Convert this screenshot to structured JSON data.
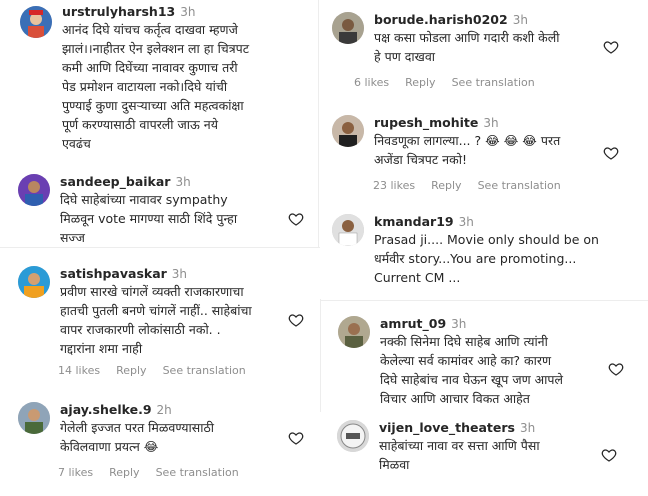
{
  "comments": [
    {
      "username": "urstrulyharsh13",
      "time": "3h",
      "text": "आनंद दिघे यांचच कर्तृत्व दाखवा म्हणजे\nझालं।।नाहीतर ऐन इलेक्शन ला हा चित्रपट\nकमी आणि दिघेंच्या नावावर कुणाच तरी\nपेड प्रमोशन वाटायला नको।दिघे यांची\nपुण्याई कुणा दुसऱ्याच्या अति महत्वकांक्षा\nपूर्ण करण्यासाठी वापरली जाऊ नये\nएवढंच",
      "likes": "",
      "reply": "",
      "translate": ""
    },
    {
      "username": "sandeep_baikar",
      "time": "3h",
      "text": "दिघे साहेबांच्या नावावर sympathy\nमिळवून vote मागण्या साठी शिंदे पुन्हा\nसज्ज",
      "likes": "",
      "reply": "",
      "translate": ""
    },
    {
      "username": "satishpavaskar",
      "time": "3h",
      "text": "प्रवीण सारखे चांगलें व्यक्ती राजकारणाचा\nहातची पुतली बनणे चांगलें नाहीं.. साहेबांचा\nवापर राजकारणी लोकांसाठी नको. .\nगद्दारांना शमा नाही",
      "likes": "14 likes",
      "reply": "Reply",
      "translate": "See translation"
    },
    {
      "username": "ajay.shelke.9",
      "time": "2h",
      "text": "गेलेली इज्जत परत मिळवण्यासाठी\nकेविलवाणा प्रयत्न 😂",
      "likes": "7 likes",
      "reply": "Reply",
      "translate": "See translation"
    },
    {
      "username": "borude.harish0202",
      "time": "3h",
      "text": "पक्ष कसा फोडला आणि गदारी कशी केली\nहे पण दाखवा",
      "likes": "6 likes",
      "reply": "Reply",
      "translate": "See translation"
    },
    {
      "username": "rupesh_mohite",
      "time": "3h",
      "text": "निवडणूका लागल्या... ? 😂 😂 😂 परत\nअजेंडा चित्रपट नको!",
      "likes": "23 likes",
      "reply": "Reply",
      "translate": "See translation"
    },
    {
      "username": "kmandar19",
      "time": "3h",
      "text": "Prasad ji.... Movie only should be on\nधर्मवीर story...You are promoting...\nCurrent CM ...",
      "likes": "",
      "reply": "",
      "translate": ""
    },
    {
      "username": "amrut_09",
      "time": "3h",
      "text": "नक्की सिनेमा दिघे साहेब आणि त्यांनी\nकेलेल्या सर्व कामांवर आहे का? कारण\nदिघे साहेबांच नाव घेऊन खूप जण आपले\nविचार आणि आचार विकत आहेत",
      "likes": "",
      "reply": "",
      "translate": ""
    },
    {
      "username": "vijen_love_theaters",
      "time": "3h",
      "text": "साहेबांच्या नावा वर सत्ता आणि पैसा\nमिळवा",
      "likes": "",
      "reply": "",
      "translate": ""
    }
  ],
  "colors": {
    "text": "#262626",
    "muted": "#8e8e8e",
    "background": "#ffffff"
  },
  "icons": {
    "like": "heart-outline-icon"
  }
}
